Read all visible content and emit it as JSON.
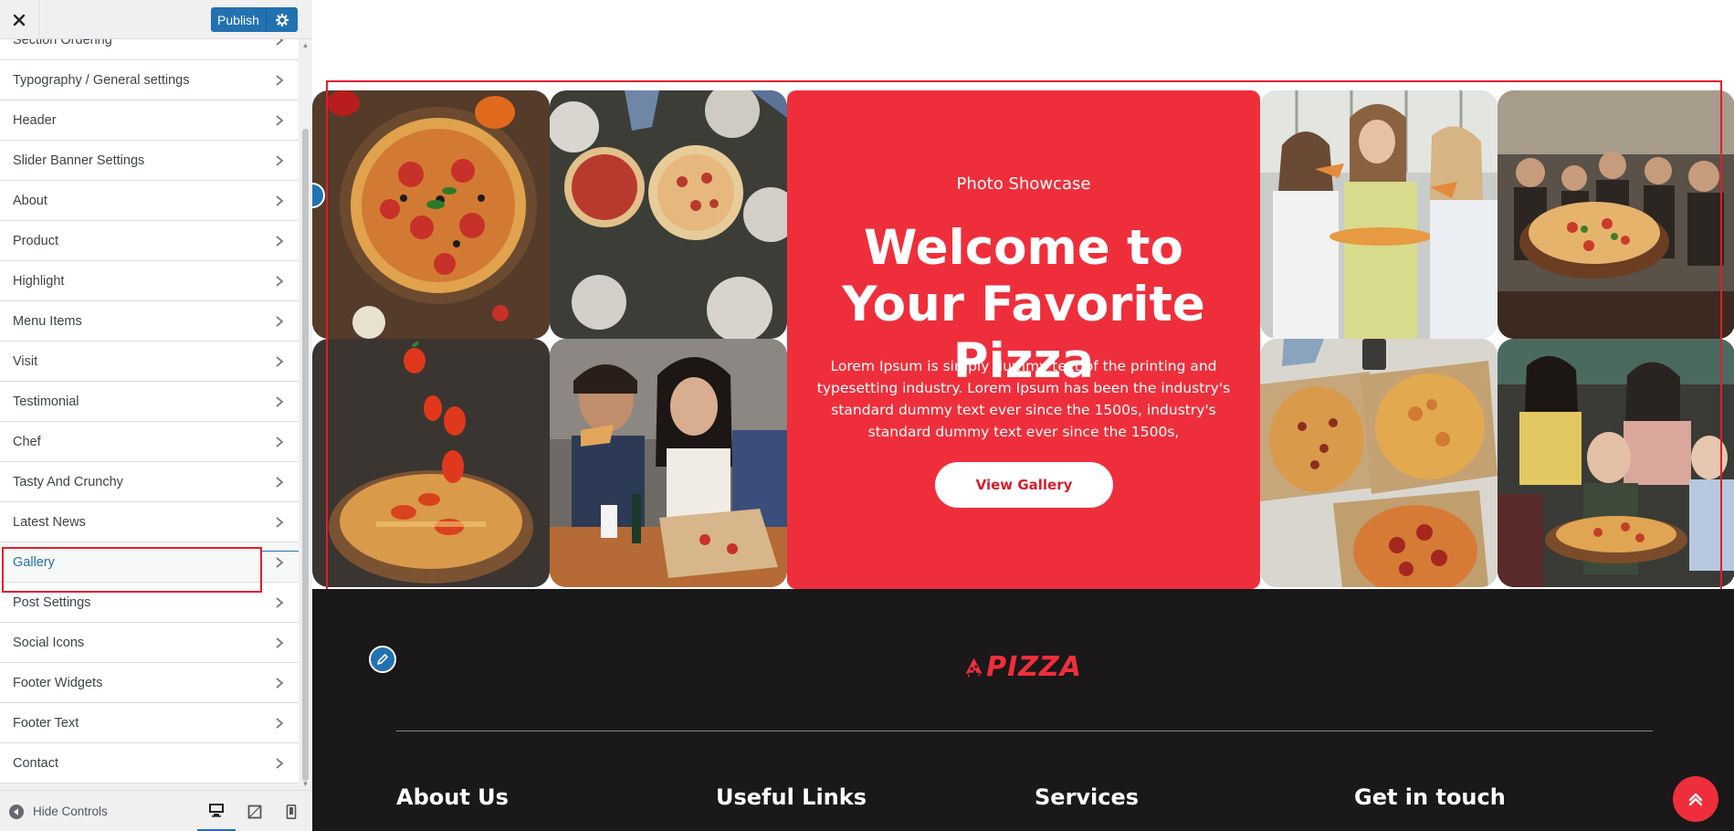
{
  "sidebar": {
    "publish_label": "Publish",
    "items": [
      {
        "label": "Section Ordering"
      },
      {
        "label": "Typography / General settings"
      },
      {
        "label": "Header"
      },
      {
        "label": "Slider Banner Settings"
      },
      {
        "label": "About"
      },
      {
        "label": "Product"
      },
      {
        "label": "Highlight"
      },
      {
        "label": "Menu Items"
      },
      {
        "label": "Visit"
      },
      {
        "label": "Testimonial"
      },
      {
        "label": "Chef"
      },
      {
        "label": "Tasty And Crunchy"
      },
      {
        "label": "Latest News"
      },
      {
        "label": "Gallery"
      },
      {
        "label": "Post Settings"
      },
      {
        "label": "Social Icons"
      },
      {
        "label": "Footer Widgets"
      },
      {
        "label": "Footer Text"
      },
      {
        "label": "Contact"
      }
    ],
    "active_item": "Gallery",
    "hide_controls_label": "Hide Controls",
    "accent_color": "#2271b1"
  },
  "gallery": {
    "eyebrow": "Photo Showcase",
    "title": "Welcome to Your Favorite Pizza",
    "description": "Lorem Ipsum is simply dummy text of the printing and typesetting industry. Lorem Ipsum has been the industry's standard dummy text ever since the 1500s, industry's standard dummy text ever since the 1500s,",
    "button_label": "View Gallery",
    "card_color": "#ee2f3b"
  },
  "footer": {
    "logo_text": "PIZZA",
    "columns": [
      "About Us",
      "Useful Links",
      "Services",
      "Get in touch"
    ]
  }
}
